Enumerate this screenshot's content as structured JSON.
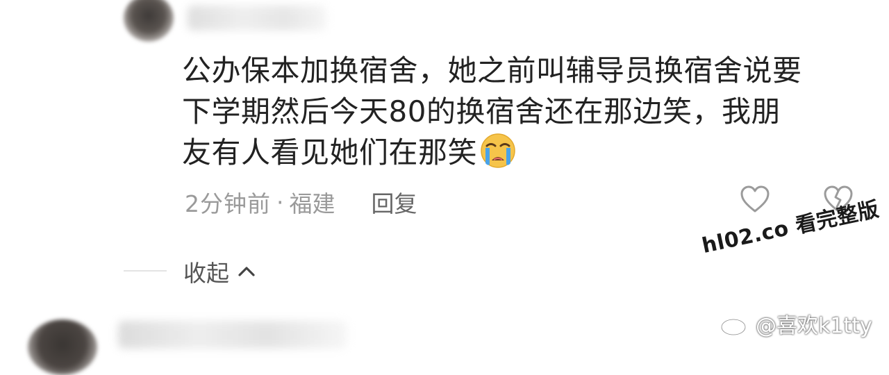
{
  "comment": {
    "lines": [
      "公办保本加换宿舍，她之前叫辅导员换宿舍说要",
      "下学期然后今天80的换宿舍还在那边笑，我朋",
      "友有人看见她们在那笑"
    ],
    "emoji": "loudly-crying-face",
    "time": "2分钟前",
    "separator": "·",
    "location": "福建",
    "reply_label": "回复"
  },
  "collapse": {
    "label": "收起"
  },
  "watermark": {
    "link_text": "hl02.co 看完整版",
    "weibo_handle": "@喜欢k1tty"
  },
  "colors": {
    "text": "#222222",
    "meta": "#9a9a9a",
    "emoji_face": "#f6c44a",
    "tears": "#4aa3e8"
  }
}
